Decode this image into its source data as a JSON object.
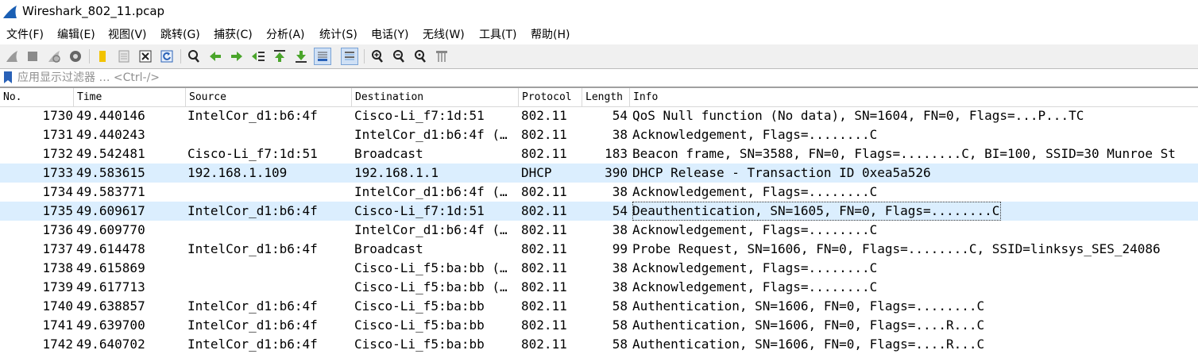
{
  "window": {
    "title": "Wireshark_802_11.pcap"
  },
  "menu": [
    "文件(F)",
    "编辑(E)",
    "视图(V)",
    "跳转(G)",
    "捕获(C)",
    "分析(A)",
    "统计(S)",
    "电话(Y)",
    "无线(W)",
    "工具(T)",
    "帮助(H)"
  ],
  "toolbar": {
    "buttons": [
      "start-capture-icon",
      "stop-capture-icon",
      "restart-capture-icon",
      "capture-options-icon",
      "open-file-icon",
      "save-file-icon",
      "close-file-icon",
      "reload-file-icon",
      "find-packet-icon",
      "go-back-icon",
      "go-forward-icon",
      "go-to-packet-icon",
      "first-packet-icon",
      "last-packet-icon",
      "autoscroll-icon",
      "colorize-icon",
      "zoom-in-icon",
      "zoom-out-icon",
      "normal-size-icon",
      "resize-columns-icon"
    ]
  },
  "filter": {
    "placeholder": "应用显示过滤器 … <Ctrl-/>",
    "value": ""
  },
  "columns": [
    "No.",
    "Time",
    "Source",
    "Destination",
    "Protocol",
    "Length",
    "Info"
  ],
  "packets": [
    {
      "no": "1730",
      "time": "49.440146",
      "source": "IntelCor_d1:b6:4f",
      "destination": "Cisco-Li_f7:1d:51",
      "protocol": "802.11",
      "length": "54",
      "info": "QoS Null function (No data), SN=1604, FN=0, Flags=...P...TC"
    },
    {
      "no": "1731",
      "time": "49.440243",
      "source": "",
      "destination": "IntelCor_d1:b6:4f (…",
      "protocol": "802.11",
      "length": "38",
      "info": "Acknowledgement, Flags=........C"
    },
    {
      "no": "1732",
      "time": "49.542481",
      "source": "Cisco-Li_f7:1d:51",
      "destination": "Broadcast",
      "protocol": "802.11",
      "length": "183",
      "info": "Beacon frame, SN=3588, FN=0, Flags=........C, BI=100, SSID=30 Munroe St"
    },
    {
      "no": "1733",
      "time": "49.583615",
      "source": "192.168.1.109",
      "destination": "192.168.1.1",
      "protocol": "DHCP",
      "length": "390",
      "info": "DHCP Release  - Transaction ID 0xea5a526"
    },
    {
      "no": "1734",
      "time": "49.583771",
      "source": "",
      "destination": "IntelCor_d1:b6:4f (…",
      "protocol": "802.11",
      "length": "38",
      "info": "Acknowledgement, Flags=........C"
    },
    {
      "no": "1735",
      "time": "49.609617",
      "source": "IntelCor_d1:b6:4f",
      "destination": "Cisco-Li_f7:1d:51",
      "protocol": "802.11",
      "length": "54",
      "info": "Deauthentication, SN=1605, FN=0, Flags=........C"
    },
    {
      "no": "1736",
      "time": "49.609770",
      "source": "",
      "destination": "IntelCor_d1:b6:4f (…",
      "protocol": "802.11",
      "length": "38",
      "info": "Acknowledgement, Flags=........C"
    },
    {
      "no": "1737",
      "time": "49.614478",
      "source": "IntelCor_d1:b6:4f",
      "destination": "Broadcast",
      "protocol": "802.11",
      "length": "99",
      "info": "Probe Request, SN=1606, FN=0, Flags=........C, SSID=linksys_SES_24086"
    },
    {
      "no": "1738",
      "time": "49.615869",
      "source": "",
      "destination": "Cisco-Li_f5:ba:bb (…",
      "protocol": "802.11",
      "length": "38",
      "info": "Acknowledgement, Flags=........C"
    },
    {
      "no": "1739",
      "time": "49.617713",
      "source": "",
      "destination": "Cisco-Li_f5:ba:bb (…",
      "protocol": "802.11",
      "length": "38",
      "info": "Acknowledgement, Flags=........C"
    },
    {
      "no": "1740",
      "time": "49.638857",
      "source": "IntelCor_d1:b6:4f",
      "destination": "Cisco-Li_f5:ba:bb",
      "protocol": "802.11",
      "length": "58",
      "info": "Authentication, SN=1606, FN=0, Flags=........C"
    },
    {
      "no": "1741",
      "time": "49.639700",
      "source": "IntelCor_d1:b6:4f",
      "destination": "Cisco-Li_f5:ba:bb",
      "protocol": "802.11",
      "length": "58",
      "info": "Authentication, SN=1606, FN=0, Flags=....R...C"
    },
    {
      "no": "1742",
      "time": "49.640702",
      "source": "IntelCor_d1:b6:4f",
      "destination": "Cisco-Li_f5:ba:bb",
      "protocol": "802.11",
      "length": "58",
      "info": "Authentication, SN=1606, FN=0, Flags=....R...C"
    }
  ],
  "colors": {
    "dhcp_row_bg": "#dbeefe",
    "selected_row_bg": "#dbeefe",
    "toolbar_bg": "#f0f0f0",
    "shark_fin": "#1a5fb4"
  },
  "selection": {
    "highlighted_rows": [
      "1733",
      "1735"
    ],
    "focused_row": "1735"
  }
}
